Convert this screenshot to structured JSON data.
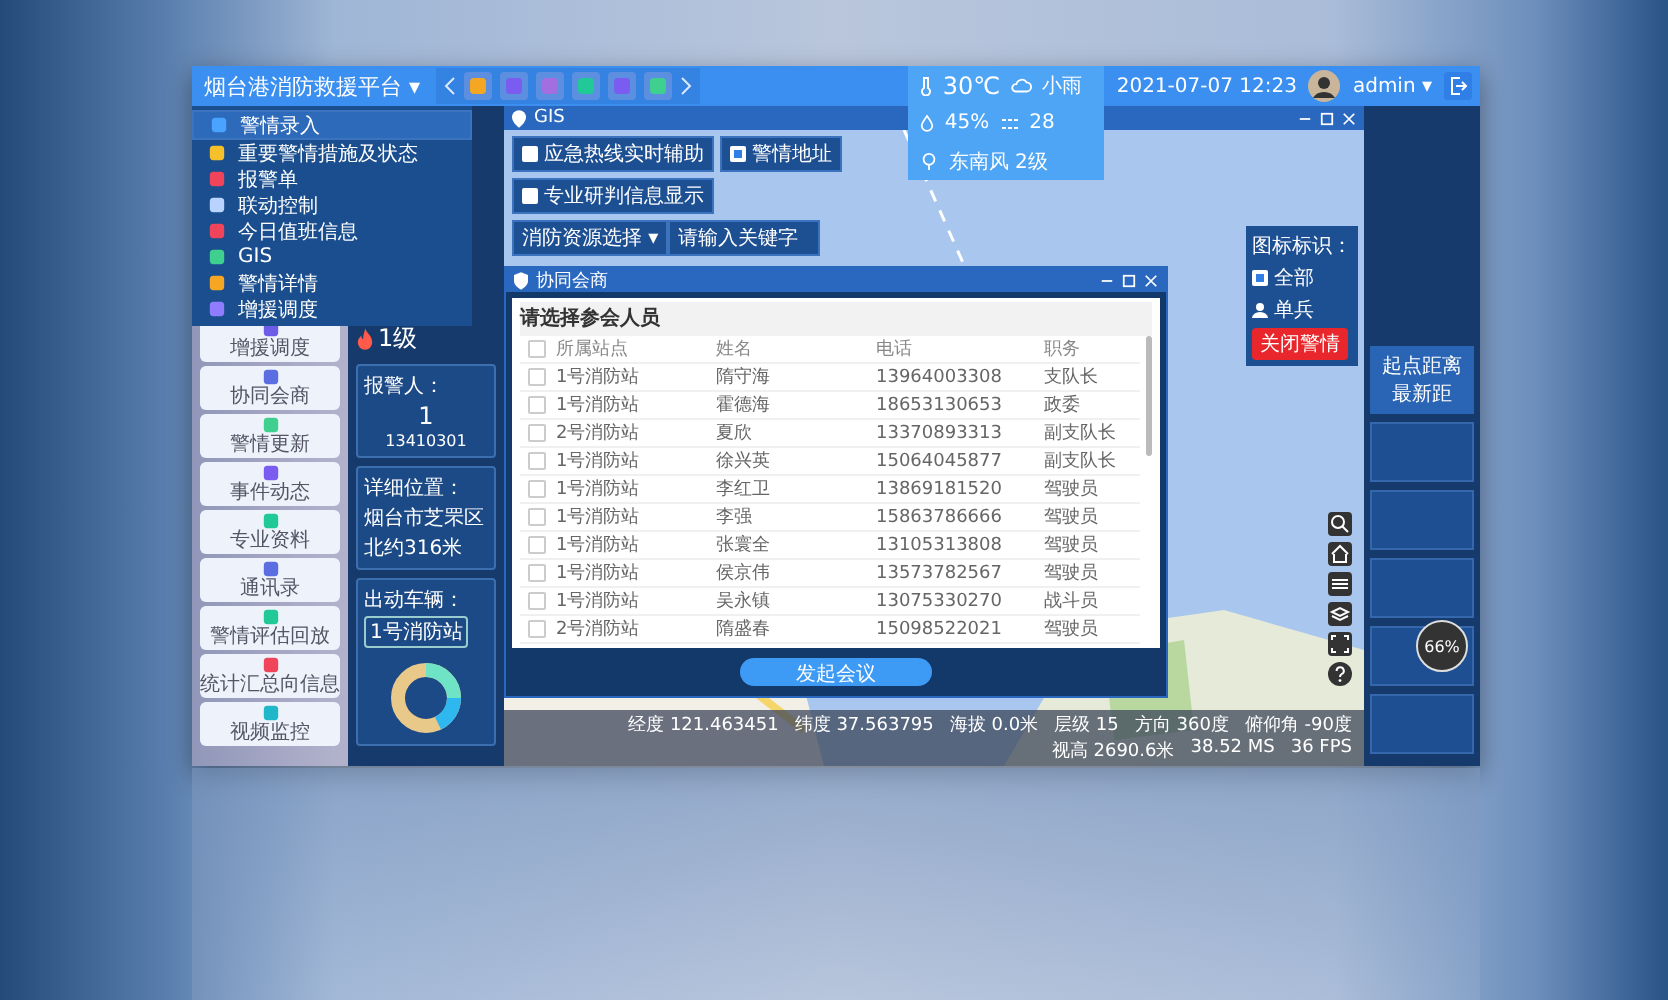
{
  "app": {
    "title": "烟台港消防救援平台",
    "title_caret": "▾",
    "datetime": "2021-07-07 12:23",
    "user": "admin",
    "user_caret": "▾"
  },
  "weather": {
    "temperature": "30℃",
    "condition": "小雨",
    "humidity": "45%",
    "aqi": "28",
    "wind": "东南风 2级"
  },
  "main_menu": [
    {
      "label": "警情录入",
      "selected": true
    },
    {
      "label": "重要警情措施及状态",
      "selected": false
    },
    {
      "label": "报警单",
      "selected": false
    },
    {
      "label": "联动控制",
      "selected": false
    },
    {
      "label": "今日值班信息",
      "selected": false
    },
    {
      "label": "GIS",
      "selected": false
    },
    {
      "label": "警情详情",
      "selected": false
    },
    {
      "label": "增援调度",
      "selected": false
    }
  ],
  "side_tools": [
    "增援调度",
    "协同会商",
    "警情更新",
    "事件动态",
    "专业资料",
    "通讯录",
    "警情评估回放",
    "统计汇总向信息",
    "视频监控"
  ],
  "incident_panel": {
    "level": "1级",
    "caller_label": "报警人：",
    "caller": "1",
    "phone": "13410301",
    "location_label": "详细位置：",
    "location": "烟台市芝罘区",
    "location_detail": "北约316米",
    "vehicles_label": "出动车辆：",
    "vehicle": "1号消防站"
  },
  "gis_window": {
    "title": "GIS",
    "toolbar": [
      {
        "label": "应急热线实时辅助",
        "checked": false
      },
      {
        "label": "警情地址",
        "checked": true
      },
      {
        "label": "专业研判信息显示",
        "checked": false
      }
    ],
    "resource_select": "消防资源选择",
    "resource_caret": "▾",
    "search_placeholder": "请输入关键字",
    "legend_label": "图标标识：",
    "legend": [
      {
        "kind": "checkbox",
        "label": "全部",
        "checked": true
      },
      {
        "kind": "person",
        "label": "单兵"
      }
    ],
    "close_alarm": "关闭警情",
    "status_bar": [
      "经度 121.463451",
      "纬度 37.563795",
      "海拔 0.0米",
      "层级 15",
      "方向 360度",
      "俯仰角 -90度",
      "视高 2690.6米",
      "38.52 MS",
      "36 FPS"
    ]
  },
  "right_panel": {
    "heading": [
      "起点距离",
      "最新距"
    ]
  },
  "dialog": {
    "title": "协同会商",
    "heading": "请选择参会人员",
    "all_checked": false,
    "columns": [
      "所属站点",
      "姓名",
      "电话",
      "职务"
    ],
    "rows": [
      {
        "station": "1号消防站",
        "name": "隋守海",
        "phone": "13964003308",
        "role": "支队长",
        "checked": false
      },
      {
        "station": "1号消防站",
        "name": "霍德海",
        "phone": "18653130653",
        "role": "政委",
        "checked": false
      },
      {
        "station": "2号消防站",
        "name": "夏欣",
        "phone": "13370893313",
        "role": "副支队长",
        "checked": false
      },
      {
        "station": "1号消防站",
        "name": "徐兴英",
        "phone": "15064045877",
        "role": "副支队长",
        "checked": false
      },
      {
        "station": "1号消防站",
        "name": "李红卫",
        "phone": "13869181520",
        "role": "驾驶员",
        "checked": false
      },
      {
        "station": "1号消防站",
        "name": "李强",
        "phone": "15863786666",
        "role": "驾驶员",
        "checked": false
      },
      {
        "station": "1号消防站",
        "name": "张寰全",
        "phone": "13105313808",
        "role": "驾驶员",
        "checked": false
      },
      {
        "station": "1号消防站",
        "name": "侯京伟",
        "phone": "13573782567",
        "role": "驾驶员",
        "checked": false
      },
      {
        "station": "1号消防站",
        "name": "吴永镇",
        "phone": "13075330270",
        "role": "战斗员",
        "checked": false
      },
      {
        "station": "2号消防站",
        "name": "隋盛春",
        "phone": "15098522021",
        "role": "驾驶员",
        "checked": false
      }
    ],
    "action": "发起会议"
  },
  "gauge": "66%"
}
